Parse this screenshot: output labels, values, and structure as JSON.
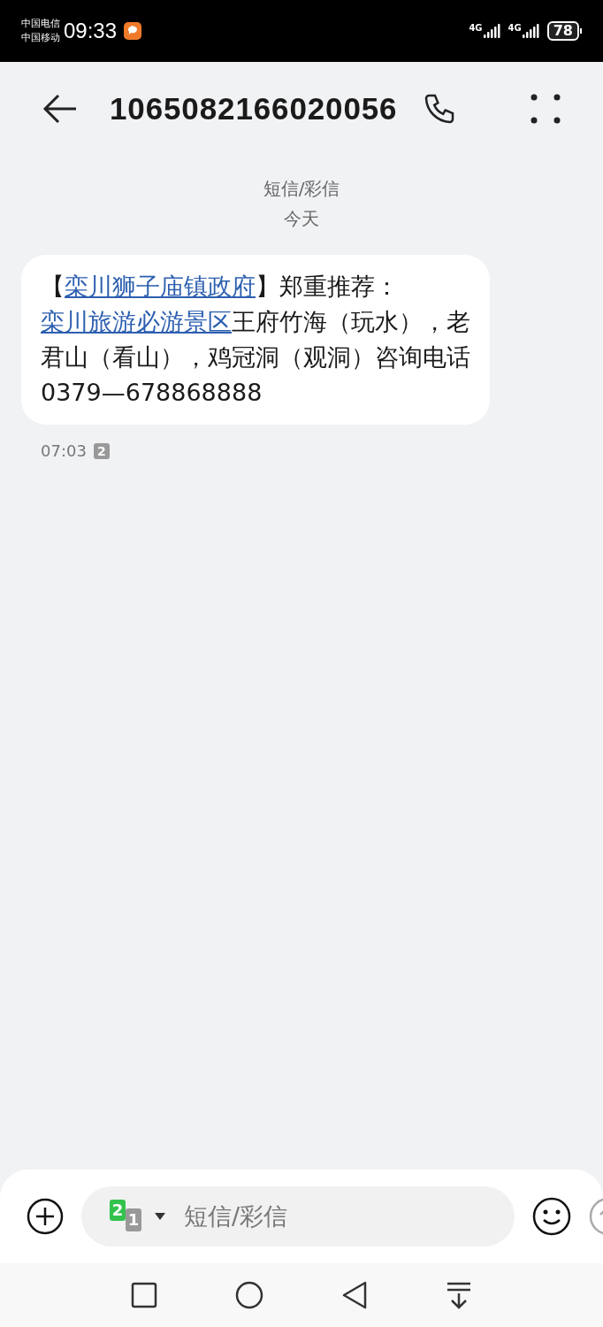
{
  "status_bar": {
    "carriers": [
      "中国电信",
      "中国移动"
    ],
    "time": "09:33",
    "signals": [
      {
        "label": "4G"
      },
      {
        "label": "4G"
      }
    ],
    "battery": "78"
  },
  "header": {
    "title": "1065082166020056"
  },
  "conversation": {
    "channel": "短信/彩信",
    "date": "今天",
    "messages": [
      {
        "segments": [
          {
            "kind": "text",
            "text": "【"
          },
          {
            "kind": "link",
            "text": "栾川狮子庙镇政府"
          },
          {
            "kind": "text",
            "text": "】郑重推荐："
          },
          {
            "kind": "link",
            "text": "栾川旅游必游景区"
          },
          {
            "kind": "text",
            "text": "王府竹海（玩水），老君山（看山），鸡冠洞（观洞）咨询电话 0379—678868888"
          }
        ],
        "time": "07:03",
        "sim": "2"
      }
    ]
  },
  "composer": {
    "sim_front": "2",
    "sim_back": "1",
    "placeholder": "短信/彩信"
  }
}
